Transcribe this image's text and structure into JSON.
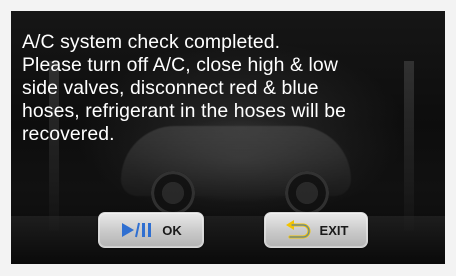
{
  "colors": {
    "icon_accent": "#2f6fd1",
    "text": "#ffffff",
    "button_text": "#1a1a1a"
  },
  "message": {
    "lines": [
      "A/C system check completed.",
      "Please turn off A/C, close high & low",
      "side valves, disconnect red & blue",
      "hoses, refrigerant in the hoses will be",
      "recovered."
    ]
  },
  "buttons": {
    "ok": {
      "label": "OK",
      "icon": "play-pause-icon"
    },
    "exit": {
      "label": "EXIT",
      "icon": "back-arrow-icon"
    }
  }
}
